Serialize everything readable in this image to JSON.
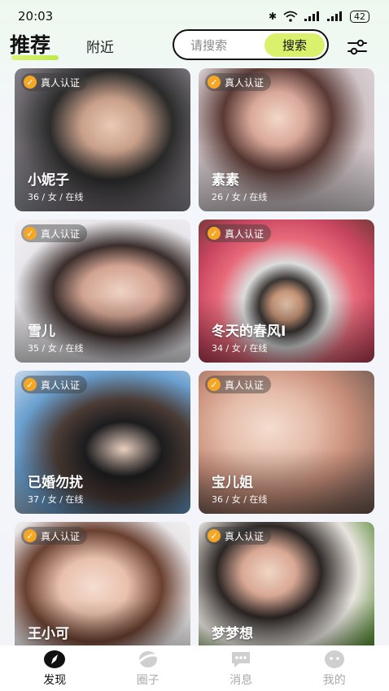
{
  "status_bar": {
    "time": "20:03",
    "battery": "42"
  },
  "header": {
    "tab_recommend": "推荐",
    "tab_nearby": "附近",
    "search_placeholder": "请搜索",
    "search_button": "搜索"
  },
  "cards": [
    {
      "badge": "真人认证",
      "name": "小妮子",
      "meta": "36 / 女 / 在线"
    },
    {
      "badge": "真人认证",
      "name": "素素",
      "meta": "26 / 女 / 在线"
    },
    {
      "badge": "真人认证",
      "name": "雪儿",
      "meta": "35 / 女 / 在线"
    },
    {
      "badge": "真人认证",
      "name": "冬天的春风I",
      "meta": "34 / 女 / 在线"
    },
    {
      "badge": "真人认证",
      "name": "已婚勿扰",
      "meta": "37 / 女 / 在线"
    },
    {
      "badge": "真人认证",
      "name": "宝儿姐",
      "meta": "36 / 女 / 在线"
    },
    {
      "badge": "真人认证",
      "name": "王小可",
      "meta": ""
    },
    {
      "badge": "真人认证",
      "name": "梦梦想",
      "meta": ""
    }
  ],
  "nav": {
    "discover": "发现",
    "circle": "圈子",
    "messages": "消息",
    "mine": "我的"
  },
  "colors": {
    "accent": "#d9f16c",
    "badge_check": "#f5a623"
  }
}
